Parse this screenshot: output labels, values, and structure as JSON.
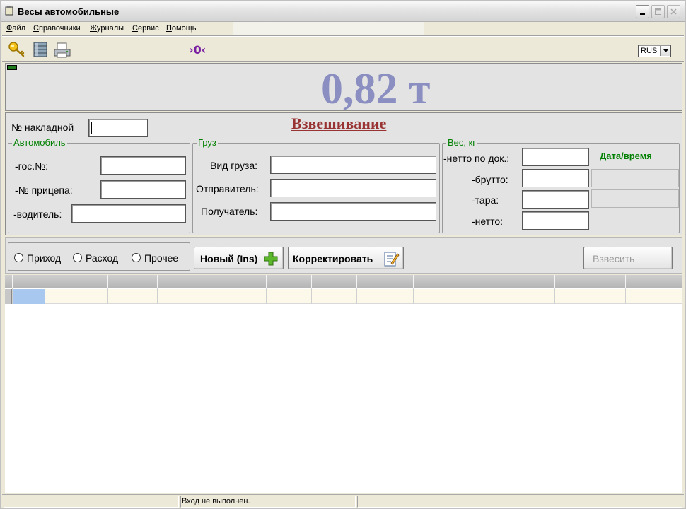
{
  "window": {
    "title": "Весы автомобильные"
  },
  "menu": [
    {
      "u": "Ф",
      "rest": "айл"
    },
    {
      "u": "С",
      "rest": "правочники"
    },
    {
      "u": "Ж",
      "rest": "урналы"
    },
    {
      "u": "С",
      "rest": "ервис"
    },
    {
      "u": "П",
      "rest": "омощь"
    }
  ],
  "toolbar": {
    "zero_label": "›0‹",
    "language": "RUS"
  },
  "display": {
    "weight": "0,82 т"
  },
  "form": {
    "heading": "Взвешивание",
    "invoice_label": "№ накладной",
    "invoice_value": "",
    "car": {
      "title": "Автомобиль",
      "plate_label": "-гос.№:",
      "trailer_label": "-№ прицепа:",
      "driver_label": "-водитель:"
    },
    "cargo": {
      "title": "Груз",
      "type_label": "Вид груза:",
      "sender_label": "Отправитель:",
      "receiver_label": "Получатель:"
    },
    "weight": {
      "title": "Вес, кг",
      "net_doc_label": "-нетто по док.:",
      "gross_label": "-брутто:",
      "tare_label": "-тара:",
      "net_label": "-нетто:",
      "datetime_label": "Дата/время"
    }
  },
  "actions": {
    "radio_in": "Приход",
    "radio_out": "Расход",
    "radio_other": "Прочее",
    "new_button": "Новый (Ins)",
    "edit_button": "Корректировать",
    "weigh_button": "Взвесить"
  },
  "status": {
    "login": "Вход не выполнен."
  },
  "colors": {
    "weight_display": "#8a8ec0",
    "heading": "#993333",
    "group_title": "#008000"
  }
}
